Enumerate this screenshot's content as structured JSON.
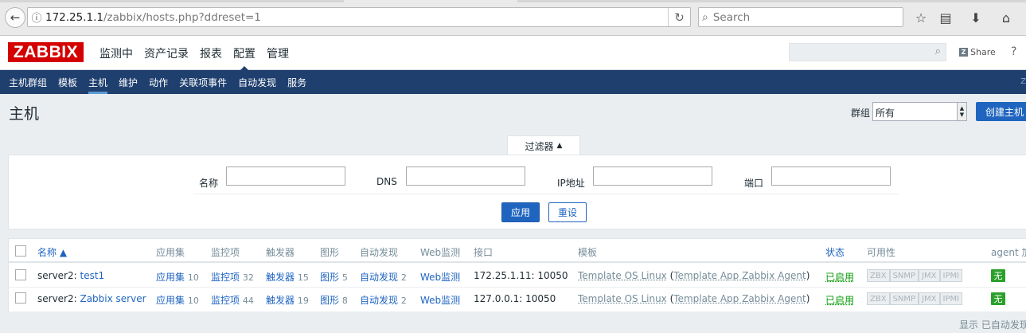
{
  "browser": {
    "url_host": "172.25.1.1",
    "url_path": "/zabbix/hosts.php?ddreset=1",
    "search_placeholder": "Search"
  },
  "header": {
    "logo": "ZABBIX",
    "menu": [
      "监测中",
      "资产记录",
      "报表",
      "配置",
      "管理"
    ],
    "selected_menu": "配置",
    "share_label": "Share",
    "help_label": "?"
  },
  "subnav": {
    "items": [
      "主机群组",
      "模板",
      "主机",
      "维护",
      "动作",
      "关联项事件",
      "自动发现",
      "服务"
    ],
    "selected": "主机",
    "right_text": "Z"
  },
  "page": {
    "title": "主机",
    "group_label": "群组",
    "group_value": "所有",
    "create_button": "创建主机"
  },
  "filter": {
    "tab_label": "过滤器",
    "fields": [
      {
        "label": "名称",
        "value": ""
      },
      {
        "label": "DNS",
        "value": ""
      },
      {
        "label": "IP地址",
        "value": ""
      },
      {
        "label": "端口",
        "value": ""
      }
    ],
    "apply": "应用",
    "reset": "重设"
  },
  "table": {
    "headers": [
      "名称 ▲",
      "应用集",
      "监控项",
      "触发器",
      "图形",
      "自动发现",
      "Web监测",
      "接口",
      "模板",
      "状态",
      "可用性",
      "agent 加"
    ],
    "rows": [
      {
        "host_prefix": "server2: ",
        "host_name": "test1",
        "apps_label": "应用集",
        "apps_count": "10",
        "items_label": "监控项",
        "items_count": "32",
        "triggers_label": "触发器",
        "triggers_count": "15",
        "graphs_label": "图形",
        "graphs_count": "5",
        "discovery_label": "自动发现",
        "discovery_count": "2",
        "web_label": "Web监测",
        "interface": "172.25.1.11: 10050",
        "template_main": "Template OS Linux",
        "template_nested": "Template App Zabbix Agent",
        "status": "已启用",
        "availability": [
          "ZBX",
          "SNMP",
          "JMX",
          "IPMI"
        ],
        "encryption": "无"
      },
      {
        "host_prefix": "server2: ",
        "host_name": "Zabbix server",
        "apps_label": "应用集",
        "apps_count": "10",
        "items_label": "监控项",
        "items_count": "44",
        "triggers_label": "触发器",
        "triggers_count": "19",
        "graphs_label": "图形",
        "graphs_count": "8",
        "discovery_label": "自动发现",
        "discovery_count": "2",
        "web_label": "Web监测",
        "interface": "127.0.0.1: 10050",
        "template_main": "Template OS Linux",
        "template_nested": "Template App Zabbix Agent",
        "status": "已启用",
        "availability": [
          "ZBX",
          "SNMP",
          "JMX",
          "IPMI"
        ],
        "encryption": "无"
      }
    ]
  },
  "footer": {
    "text": "显示 已自动发现"
  }
}
